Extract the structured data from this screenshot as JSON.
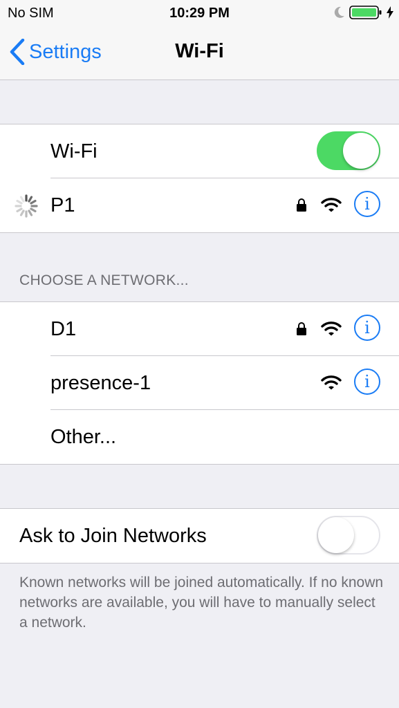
{
  "status_bar": {
    "carrier": "No SIM",
    "time": "10:29 PM",
    "battery_color": "#4cd964"
  },
  "nav": {
    "back_label": "Settings",
    "title": "Wi-Fi"
  },
  "wifi": {
    "label": "Wi-Fi",
    "enabled": true,
    "toggle_color": "#4cd964"
  },
  "current_network": {
    "name": "P1",
    "connecting": true,
    "secured": true
  },
  "choose_header": "CHOOSE A NETWORK...",
  "networks": [
    {
      "name": "D1",
      "secured": true
    },
    {
      "name": "presence-1",
      "secured": false
    }
  ],
  "other_label": "Other...",
  "ask_to_join": {
    "label": "Ask to Join Networks",
    "enabled": false,
    "footer": "Known networks will be joined automatically. If no known networks are available, you will have to manually select a network."
  },
  "accent_color": "#1a7cf5",
  "icons": [
    "chevron-left-icon",
    "moon-icon",
    "battery-icon",
    "charging-bolt-icon",
    "spinner-icon",
    "lock-icon",
    "wifi-icon",
    "info-icon"
  ]
}
